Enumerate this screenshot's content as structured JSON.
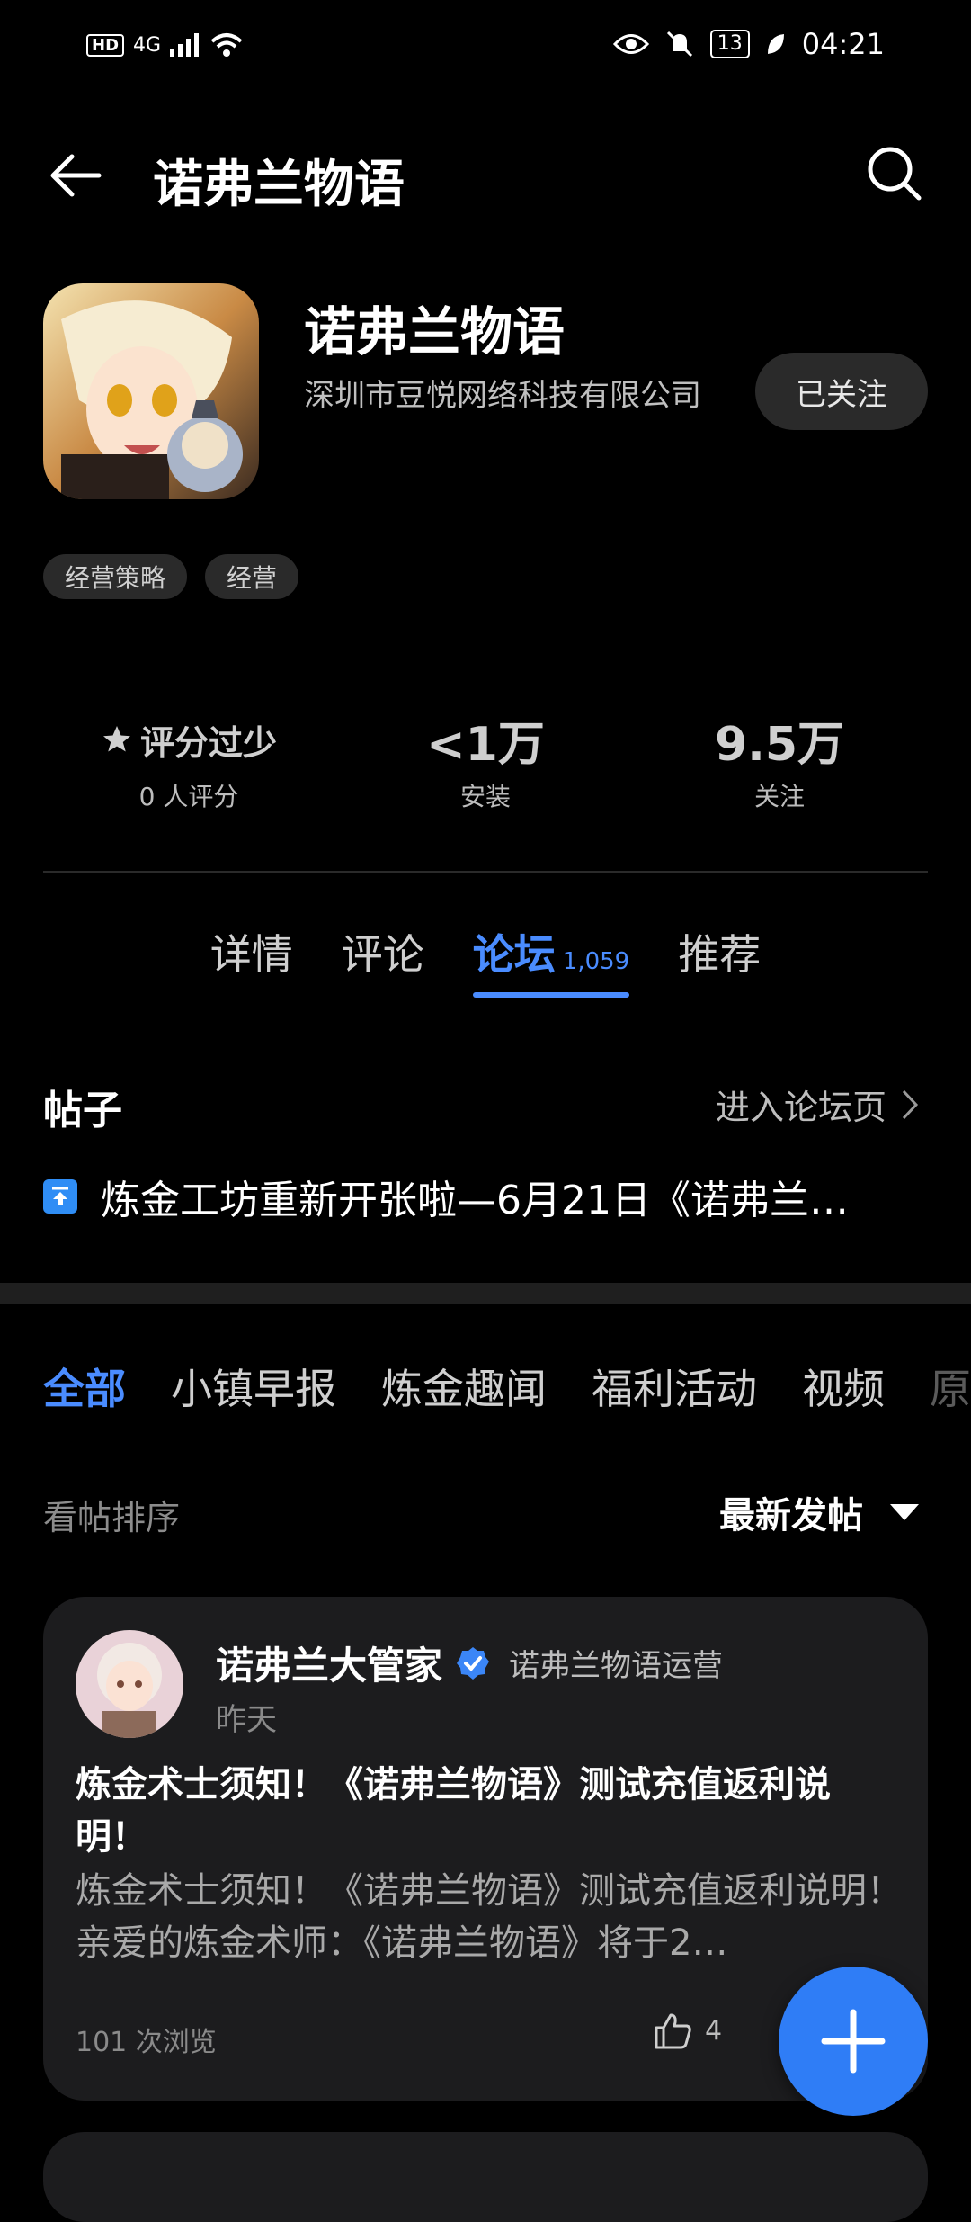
{
  "status_bar": {
    "left_hd": "HD",
    "left_net": "4G",
    "battery": "13",
    "time": "04:21"
  },
  "header": {
    "title": "诺弗兰物语"
  },
  "app": {
    "name": "诺弗兰物语",
    "developer": "深圳市豆悦网络科技有限公司",
    "follow_label": "已关注",
    "tags": [
      "经营策略",
      "经营"
    ]
  },
  "stats": {
    "rating": {
      "value": "评分过少",
      "label": "0 人评分"
    },
    "installs": {
      "value": "<1万",
      "label": "安装"
    },
    "follows": {
      "value": "9.5万",
      "label": "关注"
    }
  },
  "tabs": {
    "items": [
      {
        "label": "详情"
      },
      {
        "label": "评论"
      },
      {
        "label": "论坛",
        "count": "1,059"
      },
      {
        "label": "推荐"
      }
    ],
    "active_index": 2
  },
  "posts_section": {
    "title": "帖子",
    "enter_label": "进入论坛页",
    "pinned": "炼金工坊重新开张啦—6月21日《诺弗兰…"
  },
  "categories": {
    "items": [
      "全部",
      "小镇早报",
      "炼金趣闻",
      "福利活动",
      "视频",
      "原"
    ],
    "active_index": 0
  },
  "sort": {
    "label": "看帖排序",
    "value": "最新发帖"
  },
  "post": {
    "author": "诺弗兰大管家",
    "role": "诺弗兰物语运营",
    "time": "昨天",
    "title": "炼金术士须知！《诺弗兰物语》测试充值返利说明！",
    "body": "炼金术士须知！《诺弗兰物语》测试充值返利说明！ 亲爱的炼金术师：《诺弗兰物语》将于2…",
    "views": "101 次浏览",
    "likes": "4"
  },
  "colors": {
    "accent": "#4a8cff",
    "fab": "#2f7df6",
    "card_bg": "#1c1c1e"
  },
  "icons": {
    "back": "arrow-left-icon",
    "search": "search-icon",
    "star": "star-icon",
    "pin": "pin-top-icon",
    "chevron": "chevron-right-icon",
    "caret": "caret-down-icon",
    "verified": "verified-badge-icon",
    "like": "thumb-up-icon",
    "fab": "plus-icon"
  }
}
